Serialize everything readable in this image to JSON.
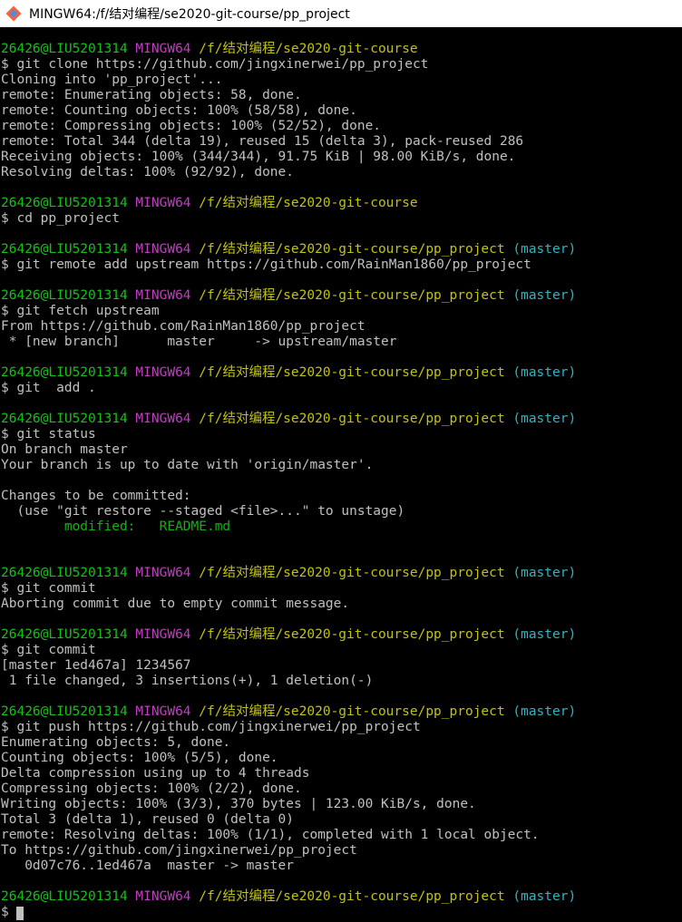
{
  "window": {
    "title": "MINGW64:/f/结对编程/se2020-git-course/pp_project",
    "icon": "git-bash-icon"
  },
  "colors": {
    "user": "#13c213",
    "host": "#c23dc2",
    "path": "#c2c213",
    "branch": "#2fb5c2",
    "text": "#c0c0c0",
    "modified": "#13b013",
    "background": "#000000"
  },
  "terminal": {
    "lines": [
      {
        "type": "prompt",
        "user": "26426@LIU5201314",
        "host": "MINGW64",
        "path": "/f/结对编程/se2020-git-course",
        "branch": ""
      },
      {
        "type": "text",
        "text": "$ git clone https://github.com/jingxinerwei/pp_project"
      },
      {
        "type": "text",
        "text": "Cloning into 'pp_project'..."
      },
      {
        "type": "text",
        "text": "remote: Enumerating objects: 58, done."
      },
      {
        "type": "text",
        "text": "remote: Counting objects: 100% (58/58), done."
      },
      {
        "type": "text",
        "text": "remote: Compressing objects: 100% (52/52), done."
      },
      {
        "type": "text",
        "text": "remote: Total 344 (delta 19), reused 15 (delta 3), pack-reused 286"
      },
      {
        "type": "text",
        "text": "Receiving objects: 100% (344/344), 91.75 KiB | 98.00 KiB/s, done."
      },
      {
        "type": "text",
        "text": "Resolving deltas: 100% (92/92), done."
      },
      {
        "type": "text",
        "text": ""
      },
      {
        "type": "prompt",
        "user": "26426@LIU5201314",
        "host": "MINGW64",
        "path": "/f/结对编程/se2020-git-course",
        "branch": ""
      },
      {
        "type": "text",
        "text": "$ cd pp_project"
      },
      {
        "type": "text",
        "text": ""
      },
      {
        "type": "prompt",
        "user": "26426@LIU5201314",
        "host": "MINGW64",
        "path": "/f/结对编程/se2020-git-course/pp_project",
        "branch": "(master)"
      },
      {
        "type": "text",
        "text": "$ git remote add upstream https://github.com/RainMan1860/pp_project"
      },
      {
        "type": "text",
        "text": ""
      },
      {
        "type": "prompt",
        "user": "26426@LIU5201314",
        "host": "MINGW64",
        "path": "/f/结对编程/se2020-git-course/pp_project",
        "branch": "(master)"
      },
      {
        "type": "text",
        "text": "$ git fetch upstream"
      },
      {
        "type": "text",
        "text": "From https://github.com/RainMan1860/pp_project"
      },
      {
        "type": "text",
        "text": " * [new branch]      master     -> upstream/master"
      },
      {
        "type": "text",
        "text": ""
      },
      {
        "type": "prompt",
        "user": "26426@LIU5201314",
        "host": "MINGW64",
        "path": "/f/结对编程/se2020-git-course/pp_project",
        "branch": "(master)"
      },
      {
        "type": "text",
        "text": "$ git  add ."
      },
      {
        "type": "text",
        "text": ""
      },
      {
        "type": "prompt",
        "user": "26426@LIU5201314",
        "host": "MINGW64",
        "path": "/f/结对编程/se2020-git-course/pp_project",
        "branch": "(master)"
      },
      {
        "type": "text",
        "text": "$ git status"
      },
      {
        "type": "text",
        "text": "On branch master"
      },
      {
        "type": "text",
        "text": "Your branch is up to date with 'origin/master'."
      },
      {
        "type": "text",
        "text": ""
      },
      {
        "type": "text",
        "text": "Changes to be committed:"
      },
      {
        "type": "text",
        "text": "  (use \"git restore --staged <file>...\" to unstage)"
      },
      {
        "type": "modified",
        "text": "        modified:   README.md"
      },
      {
        "type": "text",
        "text": ""
      },
      {
        "type": "text",
        "text": ""
      },
      {
        "type": "prompt",
        "user": "26426@LIU5201314",
        "host": "MINGW64",
        "path": "/f/结对编程/se2020-git-course/pp_project",
        "branch": "(master)"
      },
      {
        "type": "text",
        "text": "$ git commit"
      },
      {
        "type": "text",
        "text": "Aborting commit due to empty commit message."
      },
      {
        "type": "text",
        "text": ""
      },
      {
        "type": "prompt",
        "user": "26426@LIU5201314",
        "host": "MINGW64",
        "path": "/f/结对编程/se2020-git-course/pp_project",
        "branch": "(master)"
      },
      {
        "type": "text",
        "text": "$ git commit"
      },
      {
        "type": "text",
        "text": "[master 1ed467a] 1234567"
      },
      {
        "type": "text",
        "text": " 1 file changed, 3 insertions(+), 1 deletion(-)"
      },
      {
        "type": "text",
        "text": ""
      },
      {
        "type": "prompt",
        "user": "26426@LIU5201314",
        "host": "MINGW64",
        "path": "/f/结对编程/se2020-git-course/pp_project",
        "branch": "(master)"
      },
      {
        "type": "text",
        "text": "$ git push https://github.com/jingxinerwei/pp_project"
      },
      {
        "type": "text",
        "text": "Enumerating objects: 5, done."
      },
      {
        "type": "text",
        "text": "Counting objects: 100% (5/5), done."
      },
      {
        "type": "text",
        "text": "Delta compression using up to 4 threads"
      },
      {
        "type": "text",
        "text": "Compressing objects: 100% (2/2), done."
      },
      {
        "type": "text",
        "text": "Writing objects: 100% (3/3), 370 bytes | 123.00 KiB/s, done."
      },
      {
        "type": "text",
        "text": "Total 3 (delta 1), reused 0 (delta 0)"
      },
      {
        "type": "text",
        "text": "remote: Resolving deltas: 100% (1/1), completed with 1 local object."
      },
      {
        "type": "text",
        "text": "To https://github.com/jingxinerwei/pp_project"
      },
      {
        "type": "text",
        "text": "   0d07c76..1ed467a  master -> master"
      },
      {
        "type": "text",
        "text": ""
      },
      {
        "type": "prompt",
        "user": "26426@LIU5201314",
        "host": "MINGW64",
        "path": "/f/结对编程/se2020-git-course/pp_project",
        "branch": "(master)"
      },
      {
        "type": "cursor",
        "text": "$ "
      }
    ]
  }
}
